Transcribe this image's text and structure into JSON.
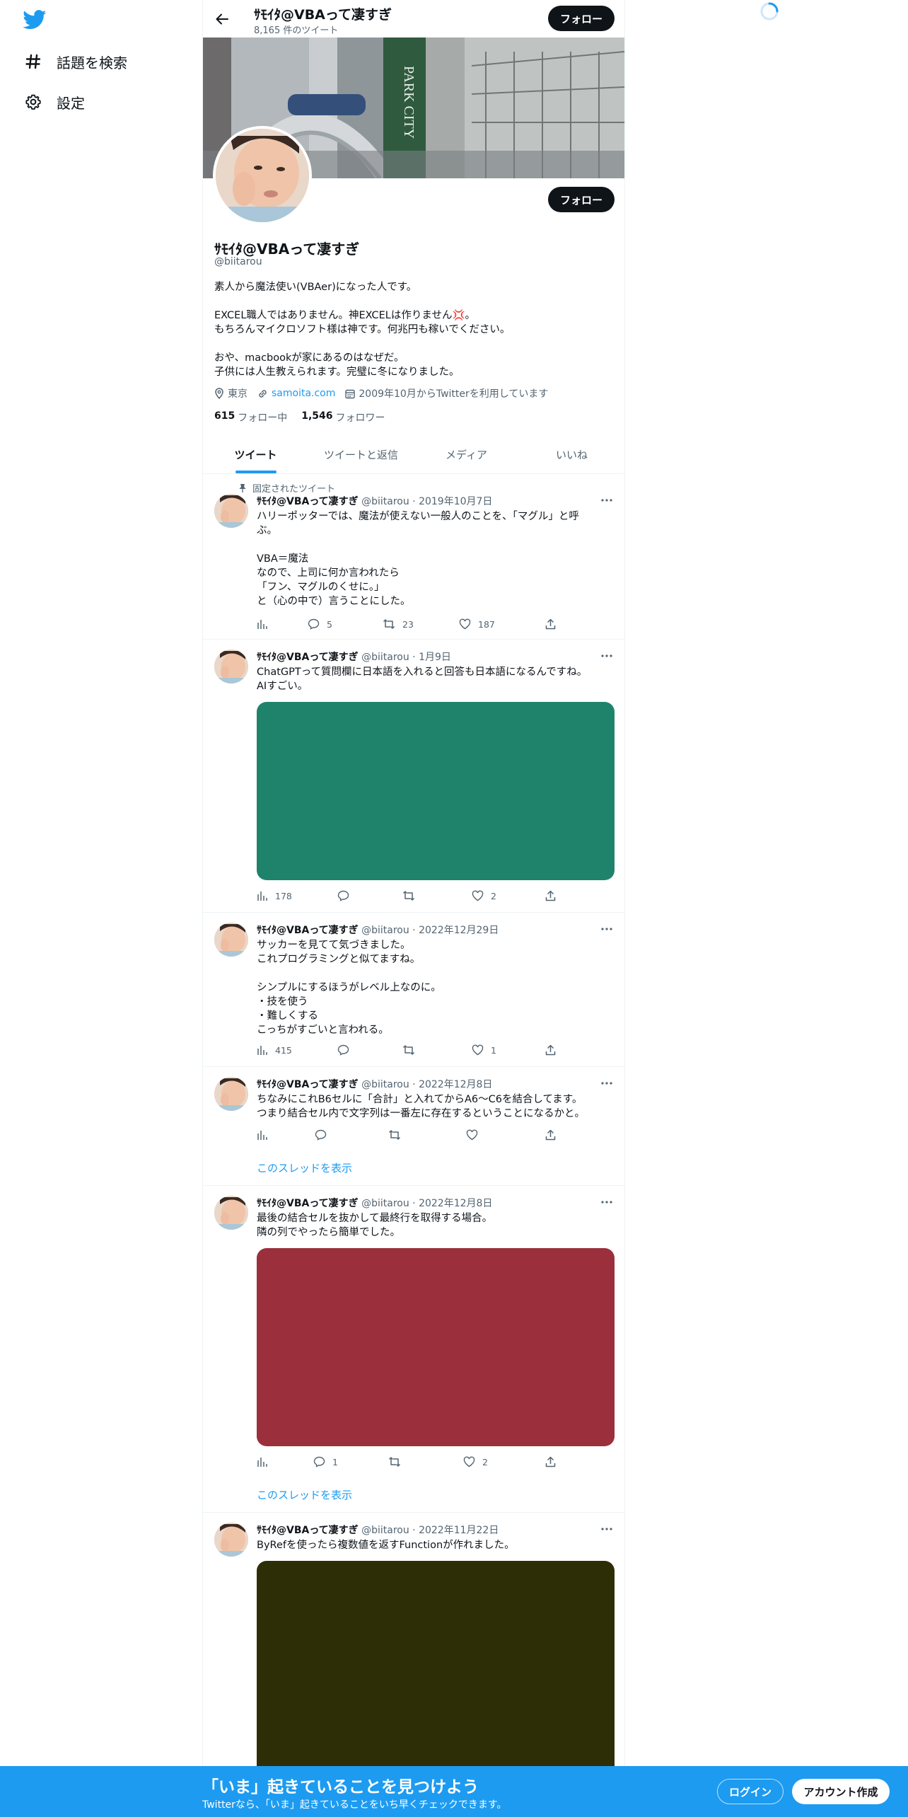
{
  "colors": {
    "accent": "#1d9bf0",
    "text": "#0f1419",
    "muted": "#536471",
    "border": "#eff3f4"
  },
  "nav": {
    "logo_icon": "twitter-bird-icon",
    "items": [
      {
        "icon": "hashtag-icon",
        "label": "話題を検索"
      },
      {
        "icon": "gear-icon",
        "label": "設定"
      }
    ]
  },
  "header": {
    "name": "ｻﾓｲﾀ@VBAって凄すぎ",
    "tweet_count": "8,165 件のツイート",
    "follow_label": "フォロー"
  },
  "profile": {
    "name": "ｻﾓｲﾀ@VBAって凄すぎ",
    "handle": "@biitarou",
    "follow_label": "フォロー",
    "bio": [
      "素人から魔法使い(VBAer)になった人です。",
      "",
      "EXCEL職人ではありません。神EXCELは作りません💢。",
      "もちろんマイクロソフト様は神です。何兆円も稼いでください。",
      "",
      "おや、macbookが家にあるのはなぜだ。",
      "子供には人生教えられます。完璧に冬になりました。"
    ],
    "location": "東京",
    "website": "samoita.com",
    "joined": "2009年10月からTwitterを利用しています",
    "following_count": "615",
    "following_label": "フォロー中",
    "followers_count": "1,546",
    "followers_label": "フォロワー"
  },
  "tabs": [
    "ツイート",
    "ツイートと返信",
    "メディア",
    "いいね"
  ],
  "pinned_label": "固定されたツイート",
  "thread_label": "このスレッドを表示",
  "tweets": [
    {
      "name": "ｻﾓｲﾀ@VBAって凄すぎ",
      "meta": "@biitarou · 2019年10月7日",
      "lines": [
        "ハリーポッターでは、魔法が使えない一般人のことを、「マグル」と呼",
        "ぶ。",
        "",
        "VBA＝魔法",
        "なので、上司に何か言われたら",
        "「フン、マグルのくせに。」",
        "と（心の中で）言うことにした。"
      ],
      "views": "",
      "replies": "5",
      "retweets": "23",
      "likes": "187"
    },
    {
      "name": "ｻﾓｲﾀ@VBAって凄すぎ",
      "meta": "@biitarou · 1月9日",
      "lines": [
        "ChatGPTって質問欄に日本語を入れると回答も日本語になるんですね。",
        "AIすごい。"
      ],
      "media_color": "#1f836c",
      "views": "178",
      "replies": "",
      "retweets": "",
      "likes": "2"
    },
    {
      "name": "ｻﾓｲﾀ@VBAって凄すぎ",
      "meta": "@biitarou · 2022年12月29日",
      "lines": [
        "サッカーを見てて気づきました。",
        "これプログラミングと似てますね。",
        "",
        "シンプルにするほうがレベル上なのに。",
        "・技を使う",
        "・難しくする",
        "こっちがすごいと言われる。"
      ],
      "views": "415",
      "replies": "",
      "retweets": "",
      "likes": "1"
    },
    {
      "name": "ｻﾓｲﾀ@VBAって凄すぎ",
      "meta": "@biitarou · 2022年12月8日",
      "lines": [
        "ちなみにこれB6セルに「合計」と入れてからA6～C6を結合してます。",
        "つまり結合セル内で文字列は一番左に存在するということになるかと。"
      ],
      "views": "",
      "replies": "",
      "retweets": "",
      "likes": ""
    },
    {
      "name": "ｻﾓｲﾀ@VBAって凄すぎ",
      "meta": "@biitarou · 2022年12月8日",
      "lines": [
        "最後の結合セルを抜かして最終行を取得する場合。",
        "隣の列でやったら簡単でした。"
      ],
      "media_color": "#9b2f3c",
      "views": "",
      "replies": "1",
      "retweets": "",
      "likes": "2"
    },
    {
      "name": "ｻﾓｲﾀ@VBAって凄すぎ",
      "meta": "@biitarou · 2022年11月22日",
      "lines": [
        "ByRefを使ったら複数値を返すFunctionが作れました。"
      ],
      "media_color": "#2e2e06"
    }
  ],
  "bottombar": {
    "title": "「いま」起きていることを見つけよう",
    "subtitle": "Twitterなら、「いま」起きていることをいち早くチェックできます。",
    "login": "ログイン",
    "signup": "アカウント作成"
  }
}
